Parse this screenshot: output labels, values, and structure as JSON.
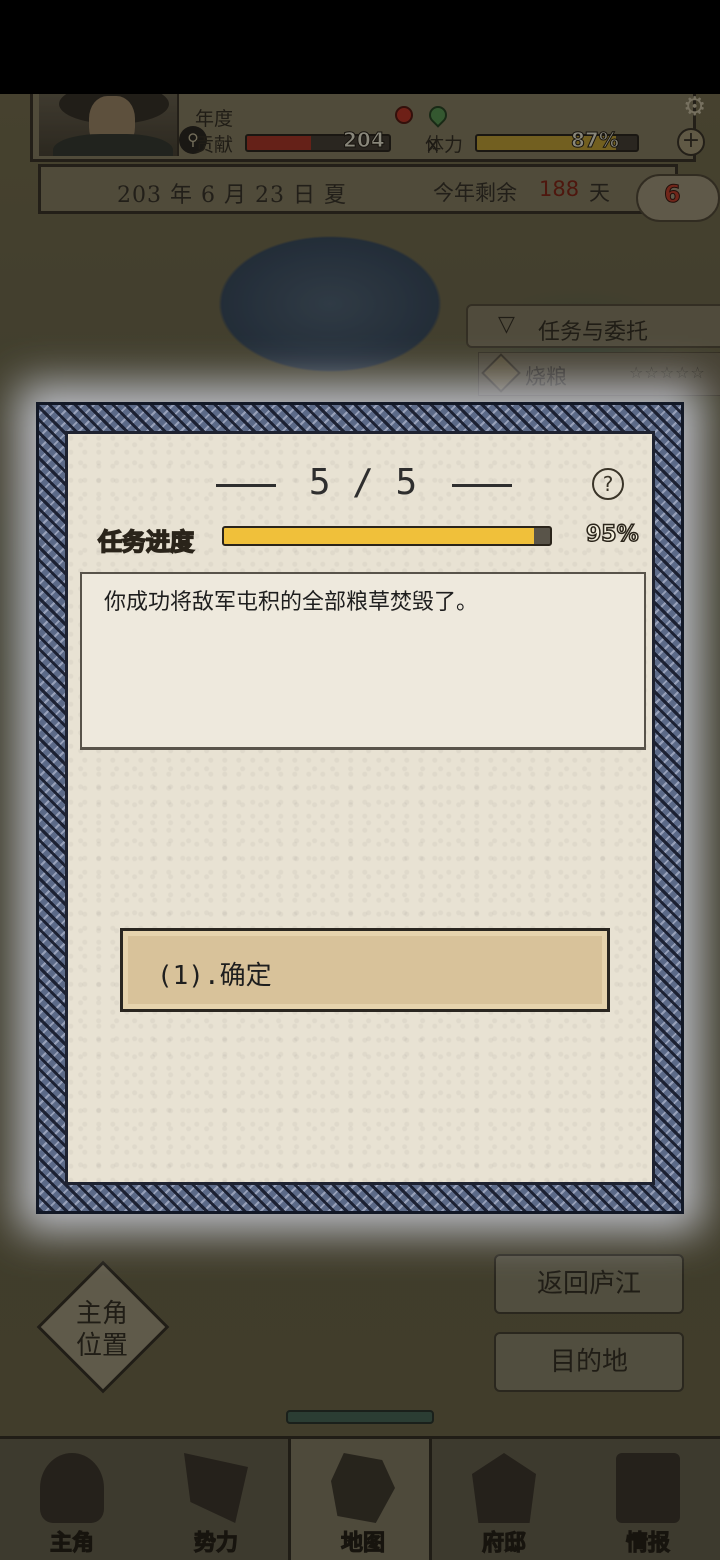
{
  "hud": {
    "annual_label": "年度",
    "contribution_label": "贡献",
    "contribution_value": "204",
    "contribution_fill": 0.45,
    "stamina_label": "体力",
    "stamina_value": "87%",
    "stamina_fill": 0.87,
    "date": "203 年 6 月 23 日 夏",
    "remaining_label": "今年剩余",
    "remaining_days": "188",
    "remaining_unit": "天",
    "badge_number": "6"
  },
  "tasks": {
    "header": "任务与委托",
    "item": "烧粮",
    "stars": "☆☆☆☆☆"
  },
  "map_controls": {
    "return_label": "返回庐江",
    "destination_label": "目的地",
    "position_label": "主角\n位置"
  },
  "nav": {
    "hero": "主角",
    "faction": "势力",
    "map": "地图",
    "mansion": "府邸",
    "intel": "情报"
  },
  "dialog": {
    "page": "5 / 5",
    "help": "?",
    "progress_label": "任务进度",
    "progress_value": "95%",
    "progress_fraction": 0.95,
    "message": "你成功将敌军屯积的全部粮草焚毁了。",
    "option": "(1).确定"
  },
  "colors": {
    "progress_fill": "#f0c03a",
    "dialog_frame": "#5c6a88",
    "paper": "#e8e2d3",
    "option_bg": "#d8c29a"
  }
}
